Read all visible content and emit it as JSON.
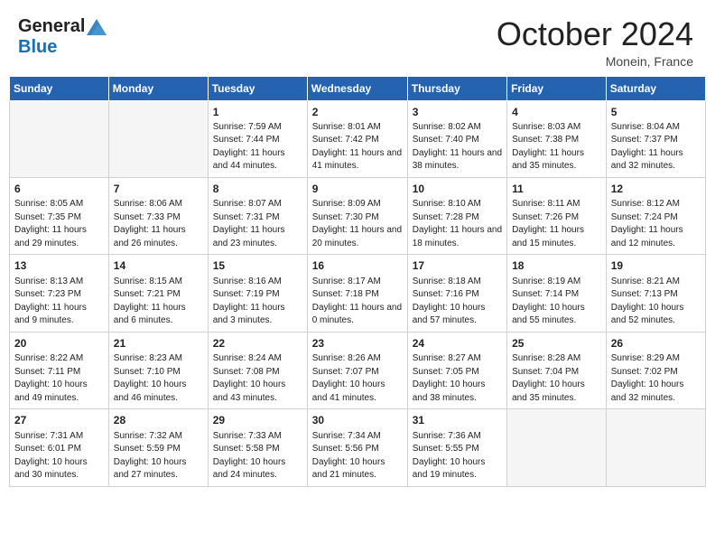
{
  "header": {
    "logo_general": "General",
    "logo_blue": "Blue",
    "month_title": "October 2024",
    "location": "Monein, France"
  },
  "weekdays": [
    "Sunday",
    "Monday",
    "Tuesday",
    "Wednesday",
    "Thursday",
    "Friday",
    "Saturday"
  ],
  "weeks": [
    [
      {
        "day": "",
        "empty": true
      },
      {
        "day": "",
        "empty": true
      },
      {
        "day": "1",
        "sunrise": "Sunrise: 7:59 AM",
        "sunset": "Sunset: 7:44 PM",
        "daylight": "Daylight: 11 hours and 44 minutes."
      },
      {
        "day": "2",
        "sunrise": "Sunrise: 8:01 AM",
        "sunset": "Sunset: 7:42 PM",
        "daylight": "Daylight: 11 hours and 41 minutes."
      },
      {
        "day": "3",
        "sunrise": "Sunrise: 8:02 AM",
        "sunset": "Sunset: 7:40 PM",
        "daylight": "Daylight: 11 hours and 38 minutes."
      },
      {
        "day": "4",
        "sunrise": "Sunrise: 8:03 AM",
        "sunset": "Sunset: 7:38 PM",
        "daylight": "Daylight: 11 hours and 35 minutes."
      },
      {
        "day": "5",
        "sunrise": "Sunrise: 8:04 AM",
        "sunset": "Sunset: 7:37 PM",
        "daylight": "Daylight: 11 hours and 32 minutes."
      }
    ],
    [
      {
        "day": "6",
        "sunrise": "Sunrise: 8:05 AM",
        "sunset": "Sunset: 7:35 PM",
        "daylight": "Daylight: 11 hours and 29 minutes."
      },
      {
        "day": "7",
        "sunrise": "Sunrise: 8:06 AM",
        "sunset": "Sunset: 7:33 PM",
        "daylight": "Daylight: 11 hours and 26 minutes."
      },
      {
        "day": "8",
        "sunrise": "Sunrise: 8:07 AM",
        "sunset": "Sunset: 7:31 PM",
        "daylight": "Daylight: 11 hours and 23 minutes."
      },
      {
        "day": "9",
        "sunrise": "Sunrise: 8:09 AM",
        "sunset": "Sunset: 7:30 PM",
        "daylight": "Daylight: 11 hours and 20 minutes."
      },
      {
        "day": "10",
        "sunrise": "Sunrise: 8:10 AM",
        "sunset": "Sunset: 7:28 PM",
        "daylight": "Daylight: 11 hours and 18 minutes."
      },
      {
        "day": "11",
        "sunrise": "Sunrise: 8:11 AM",
        "sunset": "Sunset: 7:26 PM",
        "daylight": "Daylight: 11 hours and 15 minutes."
      },
      {
        "day": "12",
        "sunrise": "Sunrise: 8:12 AM",
        "sunset": "Sunset: 7:24 PM",
        "daylight": "Daylight: 11 hours and 12 minutes."
      }
    ],
    [
      {
        "day": "13",
        "sunrise": "Sunrise: 8:13 AM",
        "sunset": "Sunset: 7:23 PM",
        "daylight": "Daylight: 11 hours and 9 minutes."
      },
      {
        "day": "14",
        "sunrise": "Sunrise: 8:15 AM",
        "sunset": "Sunset: 7:21 PM",
        "daylight": "Daylight: 11 hours and 6 minutes."
      },
      {
        "day": "15",
        "sunrise": "Sunrise: 8:16 AM",
        "sunset": "Sunset: 7:19 PM",
        "daylight": "Daylight: 11 hours and 3 minutes."
      },
      {
        "day": "16",
        "sunrise": "Sunrise: 8:17 AM",
        "sunset": "Sunset: 7:18 PM",
        "daylight": "Daylight: 11 hours and 0 minutes."
      },
      {
        "day": "17",
        "sunrise": "Sunrise: 8:18 AM",
        "sunset": "Sunset: 7:16 PM",
        "daylight": "Daylight: 10 hours and 57 minutes."
      },
      {
        "day": "18",
        "sunrise": "Sunrise: 8:19 AM",
        "sunset": "Sunset: 7:14 PM",
        "daylight": "Daylight: 10 hours and 55 minutes."
      },
      {
        "day": "19",
        "sunrise": "Sunrise: 8:21 AM",
        "sunset": "Sunset: 7:13 PM",
        "daylight": "Daylight: 10 hours and 52 minutes."
      }
    ],
    [
      {
        "day": "20",
        "sunrise": "Sunrise: 8:22 AM",
        "sunset": "Sunset: 7:11 PM",
        "daylight": "Daylight: 10 hours and 49 minutes."
      },
      {
        "day": "21",
        "sunrise": "Sunrise: 8:23 AM",
        "sunset": "Sunset: 7:10 PM",
        "daylight": "Daylight: 10 hours and 46 minutes."
      },
      {
        "day": "22",
        "sunrise": "Sunrise: 8:24 AM",
        "sunset": "Sunset: 7:08 PM",
        "daylight": "Daylight: 10 hours and 43 minutes."
      },
      {
        "day": "23",
        "sunrise": "Sunrise: 8:26 AM",
        "sunset": "Sunset: 7:07 PM",
        "daylight": "Daylight: 10 hours and 41 minutes."
      },
      {
        "day": "24",
        "sunrise": "Sunrise: 8:27 AM",
        "sunset": "Sunset: 7:05 PM",
        "daylight": "Daylight: 10 hours and 38 minutes."
      },
      {
        "day": "25",
        "sunrise": "Sunrise: 8:28 AM",
        "sunset": "Sunset: 7:04 PM",
        "daylight": "Daylight: 10 hours and 35 minutes."
      },
      {
        "day": "26",
        "sunrise": "Sunrise: 8:29 AM",
        "sunset": "Sunset: 7:02 PM",
        "daylight": "Daylight: 10 hours and 32 minutes."
      }
    ],
    [
      {
        "day": "27",
        "sunrise": "Sunrise: 7:31 AM",
        "sunset": "Sunset: 6:01 PM",
        "daylight": "Daylight: 10 hours and 30 minutes."
      },
      {
        "day": "28",
        "sunrise": "Sunrise: 7:32 AM",
        "sunset": "Sunset: 5:59 PM",
        "daylight": "Daylight: 10 hours and 27 minutes."
      },
      {
        "day": "29",
        "sunrise": "Sunrise: 7:33 AM",
        "sunset": "Sunset: 5:58 PM",
        "daylight": "Daylight: 10 hours and 24 minutes."
      },
      {
        "day": "30",
        "sunrise": "Sunrise: 7:34 AM",
        "sunset": "Sunset: 5:56 PM",
        "daylight": "Daylight: 10 hours and 21 minutes."
      },
      {
        "day": "31",
        "sunrise": "Sunrise: 7:36 AM",
        "sunset": "Sunset: 5:55 PM",
        "daylight": "Daylight: 10 hours and 19 minutes."
      },
      {
        "day": "",
        "empty": true
      },
      {
        "day": "",
        "empty": true
      }
    ]
  ]
}
